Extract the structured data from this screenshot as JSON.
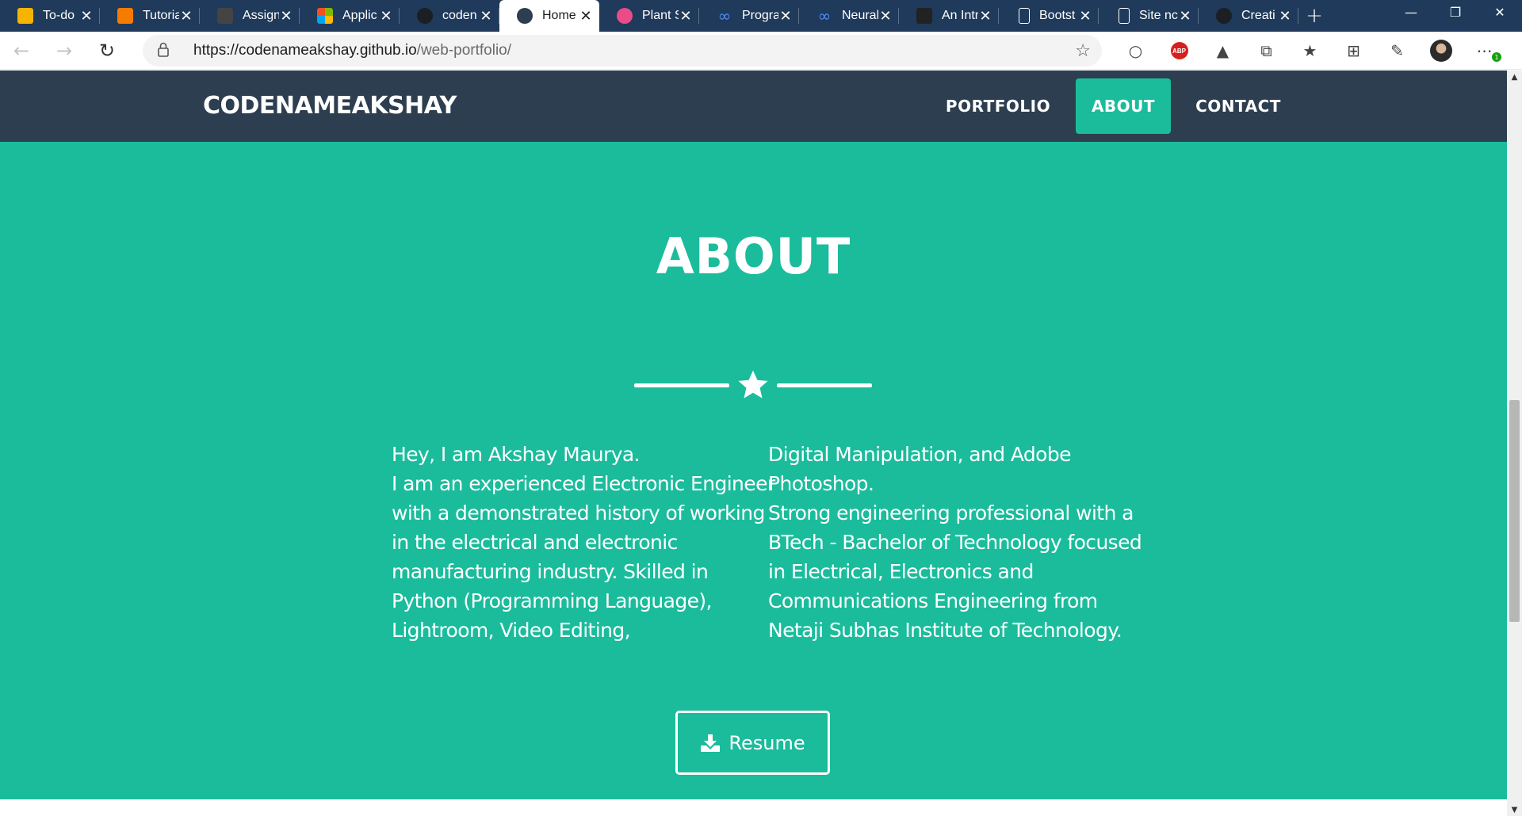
{
  "browser": {
    "tabs": [
      {
        "title": "To-do",
        "icon": "google-classroom-icon",
        "color": "#f4b400"
      },
      {
        "title": "Tutoria",
        "icon": "google-classroom-icon",
        "color": "#f57c00"
      },
      {
        "title": "Assign",
        "icon": "google-classroom-icon",
        "color": "#444444"
      },
      {
        "title": "Applic",
        "icon": "microsoft-icon",
        "color": "#f25022"
      },
      {
        "title": "coden",
        "icon": "github-icon",
        "color": "#1b1f23"
      },
      {
        "title": "Home",
        "icon": "site-favicon-icon",
        "color": "#2c3e50"
      },
      {
        "title": "Plant S",
        "icon": "dribbble-icon",
        "color": "#ea4c89"
      },
      {
        "title": "Progra",
        "icon": "coursera-icon",
        "color": "#2a73cc"
      },
      {
        "title": "Neural",
        "icon": "coursera-icon",
        "color": "#2a73cc"
      },
      {
        "title": "An Intr",
        "icon": "terminal-icon",
        "color": "#222222"
      },
      {
        "title": "Bootst",
        "icon": "page-icon",
        "color": "#ffffff"
      },
      {
        "title": "Site nc",
        "icon": "page-icon",
        "color": "#ffffff"
      },
      {
        "title": "Creati",
        "icon": "github-icon",
        "color": "#1b1f23"
      }
    ],
    "active_tab_index": 5,
    "url_host": "https://codenameakshay.github.io",
    "url_path": "/web-portfolio/",
    "abp_label": "ABP",
    "notification_count": "1"
  },
  "site": {
    "brand": "CODENAMEAKSHAY",
    "nav": {
      "portfolio": "PORTFOLIO",
      "about": "ABOUT",
      "contact": "CONTACT"
    },
    "about": {
      "title": "ABOUT",
      "left_lines": [
        "Hey, I am Akshay Maurya.",
        "I am an experienced Electronic Engineer",
        "with a demonstrated history of working",
        "in the electrical and electronic",
        "manufacturing industry. Skilled in",
        "Python (Programming Language),",
        "Lightroom, Video Editing,"
      ],
      "right_lines": [
        "Digital Manipulation, and Adobe",
        "Photoshop.",
        "Strong engineering professional with a",
        "BTech - Bachelor of Technology focused",
        "in Electrical, Electronics and",
        "Communications Engineering from",
        "Netaji Subhas Institute of Technology."
      ],
      "resume_label": "Resume"
    }
  },
  "colors": {
    "tab_bar": "#1f3a5a",
    "site_nav": "#2c3e50",
    "accent": "#1abc9c"
  }
}
